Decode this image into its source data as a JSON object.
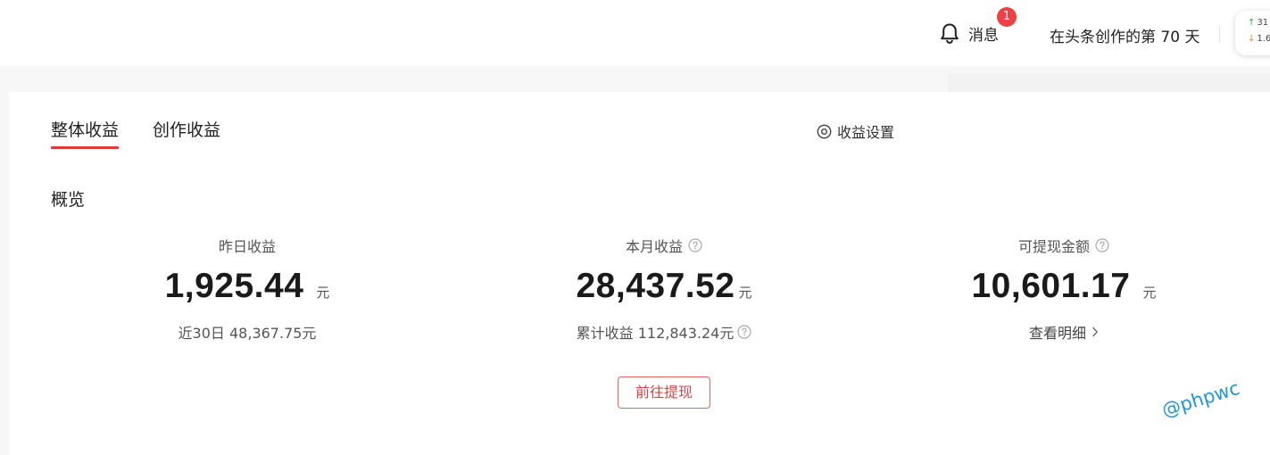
{
  "header": {
    "messages_label": "消息",
    "messages_badge": "1",
    "creation_days_text": "在头条创作的第 70 天",
    "stats": {
      "up_value": "31",
      "down_value": "1.6"
    }
  },
  "tabs": [
    {
      "label": "整体收益",
      "active": true
    },
    {
      "label": "创作收益",
      "active": false
    }
  ],
  "settings_label": "收益设置",
  "overview_title": "概览",
  "metrics": {
    "yesterday": {
      "title": "昨日收益",
      "value": "1,925.44",
      "unit": "元",
      "sub_text": "近30日 48,367.75元"
    },
    "month": {
      "title": "本月收益",
      "value": "28,437.52",
      "unit": "元",
      "sub_text": "累计收益 112,843.24元"
    },
    "withdrawable": {
      "title": "可提现金额",
      "value": "10,601.17",
      "unit": "元",
      "link_text": "查看明细"
    }
  },
  "withdraw_button_label": "前往提现",
  "watermark": "@phpwc",
  "colors": {
    "accent_red": "#e03a3a",
    "badge_red": "#f04142",
    "watermark_blue": "#2196d8",
    "trend_up_green": "#2bb24c",
    "trend_down_orange": "#e08a1e"
  },
  "icons": [
    "bell-icon",
    "settings-icon",
    "help-icon",
    "chevron-right-icon",
    "arrow-up-icon",
    "arrow-down-icon"
  ]
}
